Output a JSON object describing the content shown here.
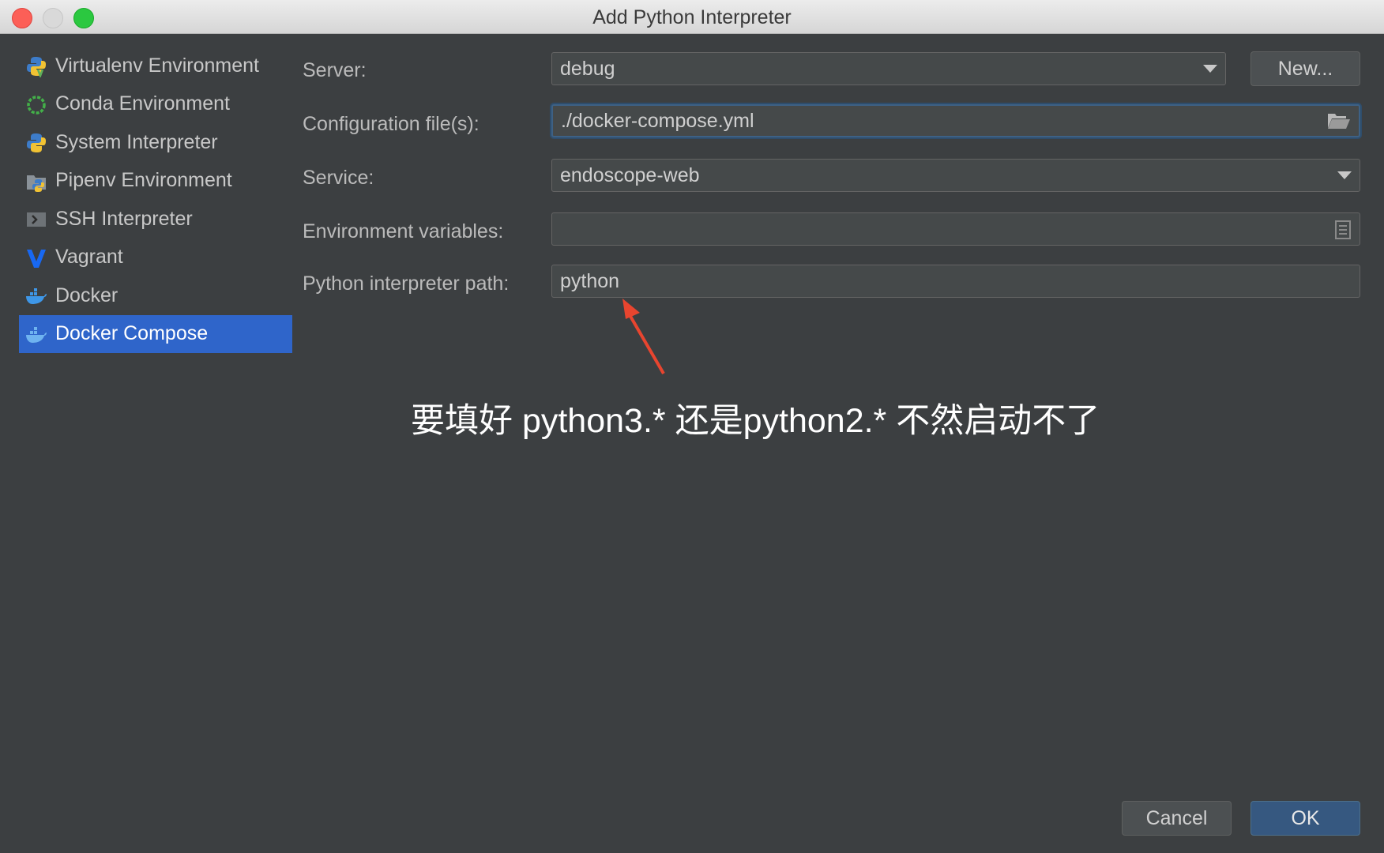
{
  "window": {
    "title": "Add Python Interpreter"
  },
  "sidebar": {
    "items": [
      {
        "label": "Virtualenv Environment",
        "icon": "python-virtualenv-icon"
      },
      {
        "label": "Conda Environment",
        "icon": "conda-icon"
      },
      {
        "label": "System Interpreter",
        "icon": "python-icon"
      },
      {
        "label": "Pipenv Environment",
        "icon": "pipenv-icon"
      },
      {
        "label": "SSH Interpreter",
        "icon": "ssh-terminal-icon"
      },
      {
        "label": "Vagrant",
        "icon": "vagrant-icon"
      },
      {
        "label": "Docker",
        "icon": "docker-icon"
      },
      {
        "label": "Docker Compose",
        "icon": "docker-compose-icon",
        "selected": true
      }
    ]
  },
  "form": {
    "server_label": "Server:",
    "server_value": "debug",
    "new_button": "New...",
    "config_label": "Configuration file(s):",
    "config_value": "./docker-compose.yml",
    "service_label": "Service:",
    "service_value": "endoscope-web",
    "env_label": "Environment variables:",
    "env_value": "",
    "path_label": "Python interpreter path:",
    "path_value": "python"
  },
  "annotation": {
    "text": "要填好 python3.* 还是python2.* 不然启动不了",
    "arrow_color": "#e8452f"
  },
  "footer": {
    "cancel": "Cancel",
    "ok": "OK"
  },
  "colors": {
    "background": "#3c3f41",
    "selection": "#2f65ca",
    "primary_button": "#365880"
  }
}
